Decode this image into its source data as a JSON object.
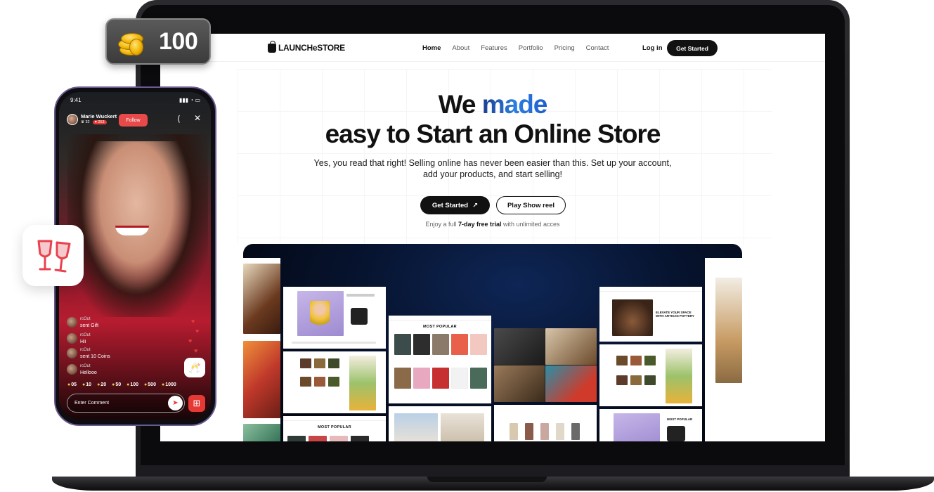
{
  "coin_badge": {
    "value": "100",
    "icon": "coins-icon"
  },
  "store_site": {
    "logo": "LAUNCHeSTORE",
    "nav": [
      "Home",
      "About",
      "Features",
      "Portfolio",
      "Pricing",
      "Contact"
    ],
    "login": "Log in",
    "nav_cta": "Get Started",
    "hero_line1_a": "We ",
    "hero_line1_b": "made",
    "hero_line2": "easy to Start an Online Store",
    "subtitle": "Yes, you read that right! Selling online has never been easier than this. Set up your account, add your products, and start selling!",
    "primary_button": "Get Started",
    "secondary_button": "Play Show reel",
    "trial_prefix": "Enjoy a full ",
    "trial_bold": "7-day free trial",
    "trial_suffix": " with unlimited acces"
  },
  "showcase": {
    "tile_titles": [
      "MOST POPULAR",
      "MOST POPULAR",
      "ELEVATE YOUR SPACE WITH ARTISAN POTTERY",
      "MOST POPULAR"
    ]
  },
  "live_stream": {
    "time": "9:41",
    "status_icons": "▮▮▮ ◔ ▭",
    "streamer": "Marie Wuckert",
    "viewers": "32",
    "likes": "253",
    "follow": "Follow",
    "chat": [
      {
        "name": "rcOut",
        "msg": "sent Gift"
      },
      {
        "name": "rcOut",
        "msg": "Hii"
      },
      {
        "name": "rcOut",
        "msg": "sent 10 Coins"
      },
      {
        "name": "rcOut",
        "msg": "Hellooo"
      }
    ],
    "coins": [
      "05",
      "10",
      "20",
      "50",
      "100",
      "500",
      "1000"
    ],
    "comment_placeholder": "Enter Comment"
  }
}
